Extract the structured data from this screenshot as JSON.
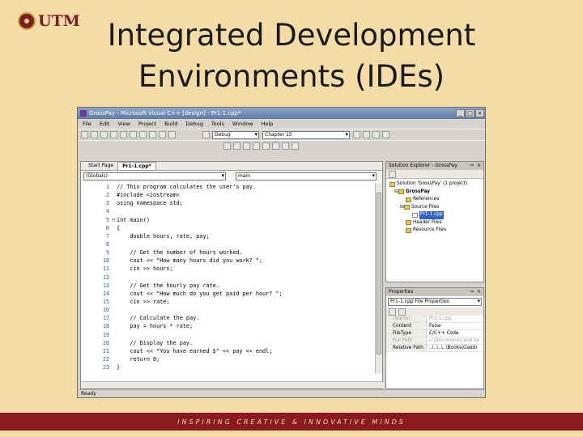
{
  "slide": {
    "title_line1": "Integrated Development",
    "title_line2": "Environments (IDEs)",
    "logo_text": "UTM",
    "banner_text": "INSPIRING CREATIVE & INNOVATIVE MINDS",
    "brand_color": "#8b1a1f"
  },
  "ide": {
    "window_title": "GrossPay - Microsoft Visual C++ [design] - Pr1-1.cpp*",
    "window_buttons": [
      "_",
      "□",
      "×"
    ],
    "menu": [
      "File",
      "Edit",
      "View",
      "Project",
      "Build",
      "Debug",
      "Tools",
      "Window",
      "Help"
    ],
    "toolbar": {
      "config": "Debug",
      "find_combo": "Chapter 15"
    },
    "tabs": [
      "Start Page",
      "Pr1-1.cpp*"
    ],
    "scope_combo": "(Globals)",
    "member_combo": "main",
    "code": [
      {
        "n": "1",
        "g": "",
        "t": "// This program calculates the user's pay."
      },
      {
        "n": "2",
        "g": "",
        "t": "#include <iostream>"
      },
      {
        "n": "3",
        "g": "",
        "t": "using namespace std;"
      },
      {
        "n": "4",
        "g": "",
        "t": ""
      },
      {
        "n": "5",
        "g": "⊟",
        "t": "int main()"
      },
      {
        "n": "6",
        "g": "",
        "t": "{"
      },
      {
        "n": "7",
        "g": "",
        "t": "    double hours, rate, pay;"
      },
      {
        "n": "8",
        "g": "",
        "t": ""
      },
      {
        "n": "9",
        "g": "",
        "t": "    // Get the number of hours worked."
      },
      {
        "n": "10",
        "g": "",
        "t": "    cout << \"How many hours did you work? \";"
      },
      {
        "n": "11",
        "g": "",
        "t": "    cin >> hours;"
      },
      {
        "n": "12",
        "g": "",
        "t": ""
      },
      {
        "n": "13",
        "g": "",
        "t": "    // Get the hourly pay rate."
      },
      {
        "n": "14",
        "g": "",
        "t": "    cout << \"How much do you get paid per hour? \";"
      },
      {
        "n": "15",
        "g": "",
        "t": "    cin >> rate;"
      },
      {
        "n": "16",
        "g": "",
        "t": ""
      },
      {
        "n": "17",
        "g": "",
        "t": "    // Calculate the pay."
      },
      {
        "n": "18",
        "g": "",
        "t": "    pay = hours * rate;"
      },
      {
        "n": "19",
        "g": "",
        "t": ""
      },
      {
        "n": "20",
        "g": "",
        "t": "    // Display the pay."
      },
      {
        "n": "21",
        "g": "",
        "t": "    cout << \"You have earned $\" << pay << endl;"
      },
      {
        "n": "22",
        "g": "",
        "t": "    return 0;"
      },
      {
        "n": "23",
        "g": "",
        "t": "}"
      }
    ],
    "solution_explorer": {
      "title": "Solution Explorer - GrossPay",
      "items": [
        {
          "label": "Solution 'GrossPay' (1 project)"
        },
        {
          "label": "GrossPay"
        },
        {
          "label": "References"
        },
        {
          "label": "Source Files"
        },
        {
          "label": "Pr1-1.cpp"
        },
        {
          "label": "Header Files"
        },
        {
          "label": "Resource Files"
        }
      ]
    },
    "properties": {
      "title": "Properties",
      "selector": "Pr1-1.cpp  File Properties",
      "rows": [
        {
          "k": "(Name)",
          "v": "Pr1-1.cpp"
        },
        {
          "k": "Content",
          "v": "False"
        },
        {
          "k": "FileType",
          "v": "C/C++ Code"
        },
        {
          "k": "Full Path",
          "v": "c:\\Documents and Se"
        },
        {
          "k": "Relative Path",
          "v": "..\\..\\..\\..\\Books\\Gaddi"
        }
      ]
    },
    "status": "Ready"
  }
}
